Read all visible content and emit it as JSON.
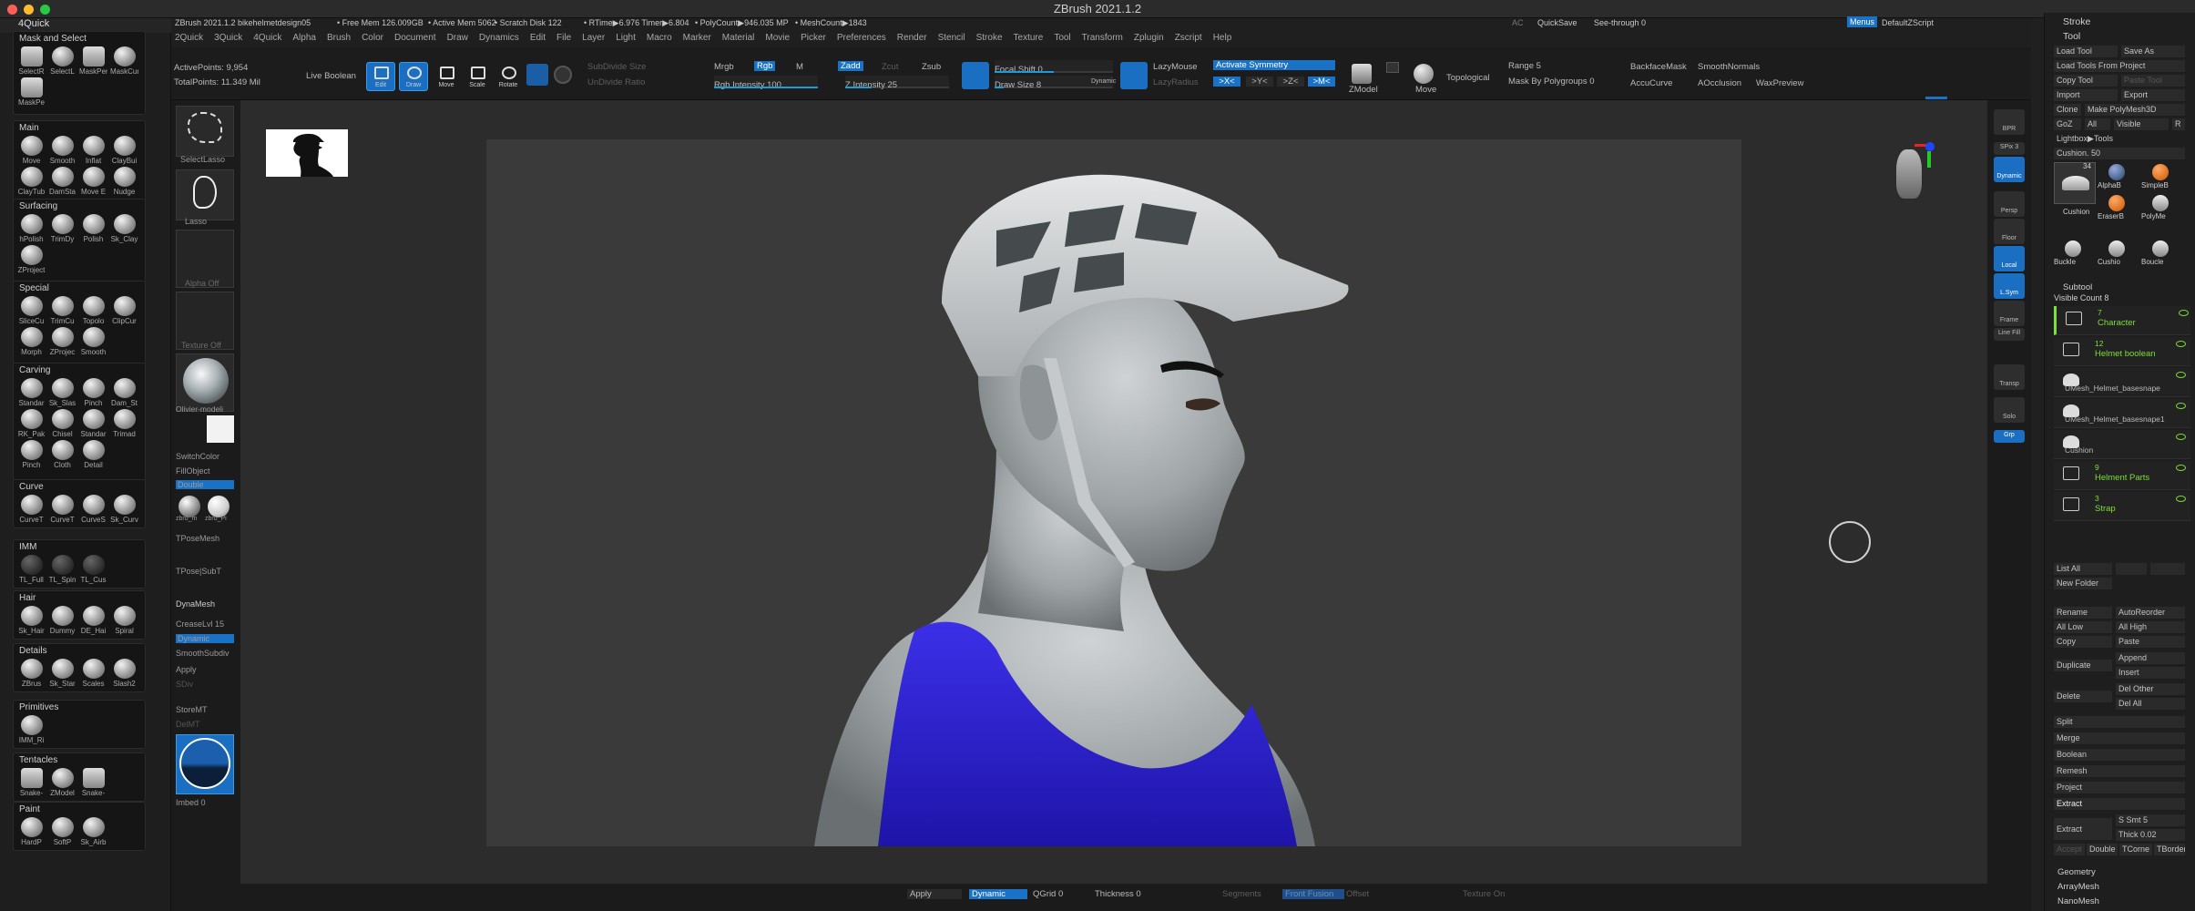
{
  "window": {
    "title": "ZBrush 2021.1.2"
  },
  "left_panel": {
    "header": "4Quick",
    "groups": [
      {
        "title": "Mask and Select",
        "items": [
          "SelectR",
          "SelectL",
          "MaskPen",
          "MaskCur",
          "MaskPe"
        ]
      },
      {
        "title": "Main",
        "items": [
          "Move",
          "Smooth",
          "Inflat",
          "ClayBui",
          "ClayTub",
          "DamSta",
          "Move E",
          "Nudge"
        ]
      },
      {
        "title": "Surfacing",
        "items": [
          "hPolish",
          "TrimDy",
          "Polish",
          "Sk_Clay",
          "ZProject"
        ]
      },
      {
        "title": "Special",
        "items": [
          "SliceCu",
          "TrimCu",
          "Topolo",
          "ClipCur",
          "Morph",
          "ZProjec",
          "Smooth"
        ]
      },
      {
        "title": "Carving",
        "items": [
          "Standar",
          "Sk_Slas",
          "Pinch",
          "Dam_St",
          "RK_Pak",
          "Chisel",
          "Standar",
          "Trimad",
          "Pinch",
          "Cloth",
          "Detail"
        ]
      },
      {
        "title": "Curve",
        "items": [
          "CurveT",
          "CurveT",
          "CurveS",
          "Sk_Curv"
        ]
      },
      {
        "title": "IMM",
        "items": [
          "TL_Full",
          "TL_Spin",
          "TL_Cus"
        ]
      },
      {
        "title": "Hair",
        "items": [
          "Sk_Hair",
          "Dummy",
          "DE_Hai",
          "Spiral"
        ]
      },
      {
        "title": "Details",
        "items": [
          "ZBrus",
          "Sk_Star",
          "Scales",
          "Slash2"
        ]
      },
      {
        "title": "Primitives",
        "items": [
          "IMM_Ri"
        ]
      },
      {
        "title": "Tentacles",
        "items": [
          "Snake-",
          "ZModel",
          "Snake-"
        ]
      },
      {
        "title": "Paint",
        "items": [
          "HardP",
          "SoftP",
          "Sk_Airb"
        ]
      }
    ]
  },
  "status": {
    "project": "ZBrush 2021.1.2 bikehelmetdesign05",
    "free_mem": "• Free Mem 126.009GB",
    "active_mem": "• Active Mem 5062",
    "scratch": "• Scratch Disk 122",
    "rtime": "• RTime▶6.976 Timer▶6.804",
    "polycount": "• PolyCount▶946.035 MP",
    "meshcount": "• MeshCount▶1843",
    "ac": "AC",
    "quicksave": "QuickSave",
    "see_through": "See-through  0",
    "menus_btn": "Menus",
    "default_zscript": "DefaultZScript"
  },
  "menus": [
    "2Quick",
    "3Quick",
    "4Quick",
    "Alpha",
    "Brush",
    "Color",
    "Document",
    "Draw",
    "Dynamics",
    "Edit",
    "File",
    "Layer",
    "Light",
    "Macro",
    "Marker",
    "Material",
    "Movie",
    "Picker",
    "Preferences",
    "Render",
    "Stencil",
    "Stroke",
    "Texture",
    "Tool",
    "Transform",
    "Zplugin",
    "Zscript",
    "Help"
  ],
  "top_shelf": {
    "active_points": "ActivePoints: 9,954",
    "total_points": "TotalPoints: 11.349 Mil",
    "live_boolean": "Live Boolean",
    "edit": "Edit",
    "draw": "Draw",
    "move": "Move",
    "scale": "Scale",
    "rotate": "Rotate",
    "subdivide_size": "SubDivide Size",
    "undivide_ratio": "UnDivide Ratio",
    "mrgb": "Mrgb",
    "rgb": "Rgb",
    "m": "M",
    "rgb_intensity": "Rgb Intensity 100",
    "zadd": "Zadd",
    "zsub": "Zsub",
    "zcut": "Zcut",
    "z_intensity": "Z Intensity 25",
    "focal_shift": "Focal Shift 0",
    "draw_size": "Draw Size 8",
    "dynamic": "Dynamic",
    "lazymouse": "LazyMouse",
    "lazyradius": "LazyRadius",
    "activate_symmetry": "Activate Symmetry",
    "sym_x": ">X<",
    "sym_y": ">Y<",
    "sym_z": ">Z<",
    "sym_m": ">M<",
    "zmodel": "ZModel",
    "move_tool": "Move",
    "topological": "Topological",
    "range": "Range 5",
    "mask_by_polygroups": "Mask By Polygroups 0",
    "backface_mask": "BackfaceMask",
    "smooth_normals": "SmoothNormals",
    "accu_curve": "AccuCurve",
    "aocclusion": "AOcclusion",
    "wax_preview": "WaxPreview",
    "rgb_intensity_level": 1.0,
    "z_intensity_level": 0.25,
    "focal_shift_level": 0.5,
    "draw_size_level": 0.08
  },
  "left_shelf": {
    "select_lasso": "SelectLasso",
    "lasso": "Lasso",
    "alpha_off": "Alpha Off",
    "texture_off": "Texture Off",
    "material": "Olivier-modeli",
    "switch_color": "SwitchColor",
    "fill_object": "FillObject",
    "double": "Double",
    "mat1": "zbro_m",
    "mat2": "zbro_Pi",
    "tpose_mesh": "TPoseMesh",
    "tpose_subt": "TPose|SubT",
    "dynamesh": "DynaMesh",
    "crease_lvl": "CreaseLvl 15",
    "dynamic": "Dynamic",
    "smooth_subdiv": "SmoothSubdiv",
    "apply": "Apply",
    "sdiv": "SDiv",
    "store_mt": "StoreMT",
    "del_mt": "DelMT",
    "imbed": "Imbed 0"
  },
  "right_shelf": [
    "BPR",
    "SPix 3",
    "Dynamic",
    "Persp",
    "Floor",
    "Local",
    "L.Sym",
    "Frame",
    "Line Fill",
    "Transp",
    "Solo",
    "Grp"
  ],
  "bottom_bar": {
    "apply": "Apply",
    "dynamic": "Dynamic",
    "qgrid": "QGrid 0",
    "thickness": "Thickness 0",
    "segments": "Segments",
    "front_fusion": "Front Fusion",
    "offset": "Offset",
    "texture_on": "Texture On"
  },
  "right_panel": {
    "stroke_title": "Stroke",
    "tool_title": "Tool",
    "load_tool": "Load Tool",
    "save_as": "Save As",
    "load_tools_from_project": "Load Tools From Project",
    "copy_tool": "Copy Tool",
    "paste_tool": "Paste Tool",
    "import": "Import",
    "export": "Export",
    "clone": "Clone",
    "make_polymesh": "Make PolyMesh3D",
    "goz": "GoZ",
    "all": "All",
    "visible": "Visible",
    "r": "R",
    "lightbox_tools": "Lightbox▶Tools",
    "cushion_value": "Cushion. 50",
    "tool_count": "34",
    "tools": [
      "Cushion",
      "AlphaB",
      "SimpleB",
      "EraserB",
      "PolyMe",
      "Buckle",
      "Cushio",
      "Boucle"
    ],
    "subtool_title": "Subtool",
    "visible_count": "Visible Count 8",
    "subtools": [
      {
        "count": "7",
        "name": "Character"
      },
      {
        "count": "12",
        "name": "Helmet boolean"
      },
      {
        "count": "",
        "name": "UMesh_Helmet_basesnape"
      },
      {
        "count": "",
        "name": "UMesh_Helmet_basesnape1"
      },
      {
        "count": "",
        "name": "Cushion"
      },
      {
        "count": "9",
        "name": "Helment Parts"
      },
      {
        "count": "3",
        "name": "Strap"
      }
    ],
    "list_all": "List All",
    "new_folder": "New Folder",
    "rename": "Rename",
    "auto_reorder": "AutoReorder",
    "all_low": "All Low",
    "all_high": "All High",
    "copy": "Copy",
    "paste": "Paste",
    "duplicate": "Duplicate",
    "append": "Append",
    "insert": "Insert",
    "delete": "Delete",
    "del_other": "Del Other",
    "del_all": "Del All",
    "split": "Split",
    "merge": "Merge",
    "boolean": "Boolean",
    "remesh": "Remesh",
    "project": "Project",
    "extract_section": "Extract",
    "extract_btn": "Extract",
    "s_smt": "S Smt 5",
    "thick": "Thick 0.02",
    "accept": "Accept",
    "double": "Double",
    "tcorne": "TCorne",
    "tborder": "TBorder",
    "geometry": "Geometry",
    "array_mesh": "ArrayMesh",
    "nano_mesh": "NanoMesh"
  },
  "colors": {
    "accent": "#1a72c6",
    "subtool_text": "#7ddf37",
    "tank_top": "#2b1fd0"
  }
}
